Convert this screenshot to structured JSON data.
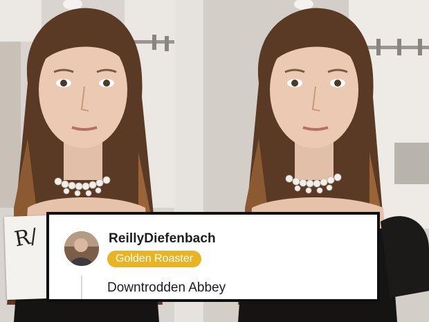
{
  "comment": {
    "username": "ReillyDiefenbach",
    "flair": "Golden Roaster",
    "text": "Downtrodden Abbey"
  },
  "note": {
    "handwriting": "R/"
  },
  "colors": {
    "flair_background": "#e8b424",
    "comment_border": "#0f0f0f"
  }
}
